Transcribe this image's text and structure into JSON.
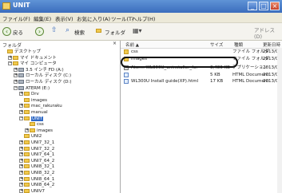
{
  "window": {
    "title": "UNIT"
  },
  "menubar": {
    "items": [
      "ファイル(F)",
      "編集(E)",
      "表示(V)",
      "お気に入り(A)",
      "ツール(T)",
      "ヘルプ(H)"
    ]
  },
  "toolbar": {
    "back_label": "戻る",
    "search_label": "検索",
    "folders_label": "フォルダ",
    "address_label": "アドレス(D)"
  },
  "tree": {
    "header": "フォルダ",
    "close_glyph": "×",
    "items": [
      {
        "label": "デスクトップ",
        "level": 0,
        "expander": "",
        "icon": "folder"
      },
      {
        "label": "マイ ドキュメント",
        "level": 1,
        "expander": "+",
        "icon": "folder"
      },
      {
        "label": "マイ コンピュータ",
        "level": 1,
        "expander": "−",
        "icon": "folder"
      },
      {
        "label": "3.5 インチ FD (A:)",
        "level": 2,
        "expander": "+",
        "icon": "drive"
      },
      {
        "label": "ローカル ディスク (C:)",
        "level": 2,
        "expander": "+",
        "icon": "drive"
      },
      {
        "label": "ローカル ディスク (D:)",
        "level": 2,
        "expander": "+",
        "icon": "drive"
      },
      {
        "label": "ATERM (E:)",
        "level": 2,
        "expander": "−",
        "icon": "drive"
      },
      {
        "label": "Drv",
        "level": 3,
        "expander": "+",
        "icon": "folder"
      },
      {
        "label": "images",
        "level": 3,
        "expander": "",
        "icon": "folder"
      },
      {
        "label": "mac_rakuraku",
        "level": 3,
        "expander": "+",
        "icon": "folder"
      },
      {
        "label": "manual",
        "level": 3,
        "expander": "+",
        "icon": "folder"
      },
      {
        "label": "UNIT",
        "level": 3,
        "expander": "−",
        "icon": "folder",
        "selected": true
      },
      {
        "label": "css",
        "level": 4,
        "expander": "",
        "icon": "folder"
      },
      {
        "label": "images",
        "level": 4,
        "expander": "+",
        "icon": "folder"
      },
      {
        "label": "UNI2",
        "level": 3,
        "expander": "",
        "icon": "folder"
      },
      {
        "label": "UNI7_32_1",
        "level": 3,
        "expander": "+",
        "icon": "folder"
      },
      {
        "label": "UNI7_32_2",
        "level": 3,
        "expander": "+",
        "icon": "folder"
      },
      {
        "label": "UNI7_64_1",
        "level": 3,
        "expander": "+",
        "icon": "folder"
      },
      {
        "label": "UNI7_64_2",
        "level": 3,
        "expander": "+",
        "icon": "folder"
      },
      {
        "label": "UNI8_32_1",
        "level": 3,
        "expander": "+",
        "icon": "folder"
      },
      {
        "label": "UNI8_32_2",
        "level": 3,
        "expander": "+",
        "icon": "folder"
      },
      {
        "label": "UNI8_64_1",
        "level": 3,
        "expander": "+",
        "icon": "folder"
      },
      {
        "label": "UNI8_64_2",
        "level": 3,
        "expander": "+",
        "icon": "folder"
      },
      {
        "label": "UNIV7",
        "level": 3,
        "expander": "+",
        "icon": "folder"
      },
      {
        "label": "UNIV8",
        "level": 3,
        "expander": "+",
        "icon": "folder"
      }
    ]
  },
  "filelist": {
    "columns": {
      "name": "名前 ▲",
      "size": "サイズ",
      "type": "種類",
      "modified": "更新日時"
    },
    "rows": [
      {
        "name": "css",
        "size": "",
        "type": "ファイル フォルダ",
        "modified": "2013/02/1",
        "icon": "folder"
      },
      {
        "name": "images",
        "size": "",
        "type": "ファイル フォルダ",
        "modified": "2013/02/1",
        "icon": "folder"
      },
      {
        "name": "Aterm WL300U_uninstaller_for",
        "size": "3,486 KB",
        "type": "アプリケーション",
        "modified": "2013/02/1",
        "icon": "exe",
        "highlighted": true
      },
      {
        "name": "",
        "size": "5 KB",
        "type": "HTML Document",
        "modified": "2013/02/1",
        "icon": "html"
      },
      {
        "name": "WL300U Install guide(XP).html",
        "size": "17 KB",
        "type": "HTML Document",
        "modified": "2013/02/0",
        "icon": "html"
      }
    ]
  }
}
